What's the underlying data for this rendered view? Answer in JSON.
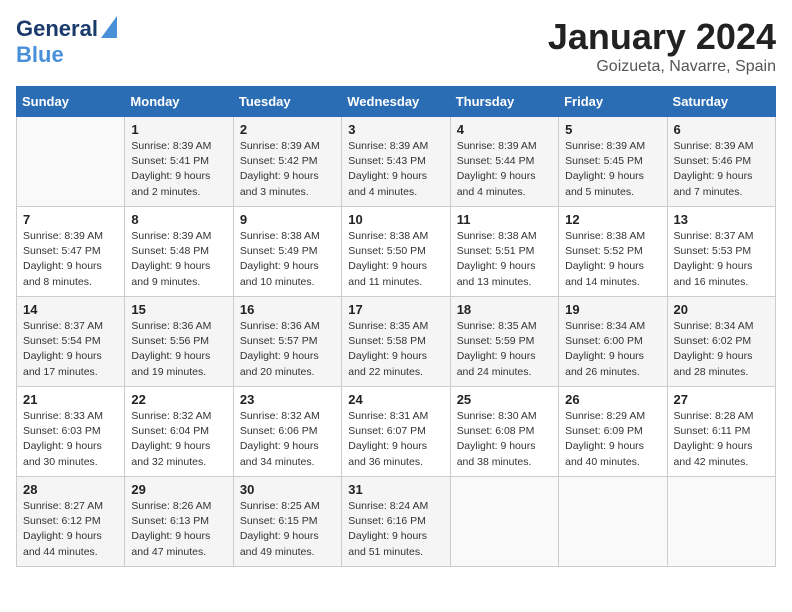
{
  "header": {
    "logo_line1": "General",
    "logo_line2": "Blue",
    "title": "January 2024",
    "subtitle": "Goizueta, Navarre, Spain"
  },
  "weekdays": [
    "Sunday",
    "Monday",
    "Tuesday",
    "Wednesday",
    "Thursday",
    "Friday",
    "Saturday"
  ],
  "weeks": [
    [
      {
        "day": "",
        "sunrise": "",
        "sunset": "",
        "daylight": ""
      },
      {
        "day": "1",
        "sunrise": "Sunrise: 8:39 AM",
        "sunset": "Sunset: 5:41 PM",
        "daylight": "Daylight: 9 hours and 2 minutes."
      },
      {
        "day": "2",
        "sunrise": "Sunrise: 8:39 AM",
        "sunset": "Sunset: 5:42 PM",
        "daylight": "Daylight: 9 hours and 3 minutes."
      },
      {
        "day": "3",
        "sunrise": "Sunrise: 8:39 AM",
        "sunset": "Sunset: 5:43 PM",
        "daylight": "Daylight: 9 hours and 4 minutes."
      },
      {
        "day": "4",
        "sunrise": "Sunrise: 8:39 AM",
        "sunset": "Sunset: 5:44 PM",
        "daylight": "Daylight: 9 hours and 4 minutes."
      },
      {
        "day": "5",
        "sunrise": "Sunrise: 8:39 AM",
        "sunset": "Sunset: 5:45 PM",
        "daylight": "Daylight: 9 hours and 5 minutes."
      },
      {
        "day": "6",
        "sunrise": "Sunrise: 8:39 AM",
        "sunset": "Sunset: 5:46 PM",
        "daylight": "Daylight: 9 hours and 7 minutes."
      }
    ],
    [
      {
        "day": "7",
        "sunrise": "Sunrise: 8:39 AM",
        "sunset": "Sunset: 5:47 PM",
        "daylight": "Daylight: 9 hours and 8 minutes."
      },
      {
        "day": "8",
        "sunrise": "Sunrise: 8:39 AM",
        "sunset": "Sunset: 5:48 PM",
        "daylight": "Daylight: 9 hours and 9 minutes."
      },
      {
        "day": "9",
        "sunrise": "Sunrise: 8:38 AM",
        "sunset": "Sunset: 5:49 PM",
        "daylight": "Daylight: 9 hours and 10 minutes."
      },
      {
        "day": "10",
        "sunrise": "Sunrise: 8:38 AM",
        "sunset": "Sunset: 5:50 PM",
        "daylight": "Daylight: 9 hours and 11 minutes."
      },
      {
        "day": "11",
        "sunrise": "Sunrise: 8:38 AM",
        "sunset": "Sunset: 5:51 PM",
        "daylight": "Daylight: 9 hours and 13 minutes."
      },
      {
        "day": "12",
        "sunrise": "Sunrise: 8:38 AM",
        "sunset": "Sunset: 5:52 PM",
        "daylight": "Daylight: 9 hours and 14 minutes."
      },
      {
        "day": "13",
        "sunrise": "Sunrise: 8:37 AM",
        "sunset": "Sunset: 5:53 PM",
        "daylight": "Daylight: 9 hours and 16 minutes."
      }
    ],
    [
      {
        "day": "14",
        "sunrise": "Sunrise: 8:37 AM",
        "sunset": "Sunset: 5:54 PM",
        "daylight": "Daylight: 9 hours and 17 minutes."
      },
      {
        "day": "15",
        "sunrise": "Sunrise: 8:36 AM",
        "sunset": "Sunset: 5:56 PM",
        "daylight": "Daylight: 9 hours and 19 minutes."
      },
      {
        "day": "16",
        "sunrise": "Sunrise: 8:36 AM",
        "sunset": "Sunset: 5:57 PM",
        "daylight": "Daylight: 9 hours and 20 minutes."
      },
      {
        "day": "17",
        "sunrise": "Sunrise: 8:35 AM",
        "sunset": "Sunset: 5:58 PM",
        "daylight": "Daylight: 9 hours and 22 minutes."
      },
      {
        "day": "18",
        "sunrise": "Sunrise: 8:35 AM",
        "sunset": "Sunset: 5:59 PM",
        "daylight": "Daylight: 9 hours and 24 minutes."
      },
      {
        "day": "19",
        "sunrise": "Sunrise: 8:34 AM",
        "sunset": "Sunset: 6:00 PM",
        "daylight": "Daylight: 9 hours and 26 minutes."
      },
      {
        "day": "20",
        "sunrise": "Sunrise: 8:34 AM",
        "sunset": "Sunset: 6:02 PM",
        "daylight": "Daylight: 9 hours and 28 minutes."
      }
    ],
    [
      {
        "day": "21",
        "sunrise": "Sunrise: 8:33 AM",
        "sunset": "Sunset: 6:03 PM",
        "daylight": "Daylight: 9 hours and 30 minutes."
      },
      {
        "day": "22",
        "sunrise": "Sunrise: 8:32 AM",
        "sunset": "Sunset: 6:04 PM",
        "daylight": "Daylight: 9 hours and 32 minutes."
      },
      {
        "day": "23",
        "sunrise": "Sunrise: 8:32 AM",
        "sunset": "Sunset: 6:06 PM",
        "daylight": "Daylight: 9 hours and 34 minutes."
      },
      {
        "day": "24",
        "sunrise": "Sunrise: 8:31 AM",
        "sunset": "Sunset: 6:07 PM",
        "daylight": "Daylight: 9 hours and 36 minutes."
      },
      {
        "day": "25",
        "sunrise": "Sunrise: 8:30 AM",
        "sunset": "Sunset: 6:08 PM",
        "daylight": "Daylight: 9 hours and 38 minutes."
      },
      {
        "day": "26",
        "sunrise": "Sunrise: 8:29 AM",
        "sunset": "Sunset: 6:09 PM",
        "daylight": "Daylight: 9 hours and 40 minutes."
      },
      {
        "day": "27",
        "sunrise": "Sunrise: 8:28 AM",
        "sunset": "Sunset: 6:11 PM",
        "daylight": "Daylight: 9 hours and 42 minutes."
      }
    ],
    [
      {
        "day": "28",
        "sunrise": "Sunrise: 8:27 AM",
        "sunset": "Sunset: 6:12 PM",
        "daylight": "Daylight: 9 hours and 44 minutes."
      },
      {
        "day": "29",
        "sunrise": "Sunrise: 8:26 AM",
        "sunset": "Sunset: 6:13 PM",
        "daylight": "Daylight: 9 hours and 47 minutes."
      },
      {
        "day": "30",
        "sunrise": "Sunrise: 8:25 AM",
        "sunset": "Sunset: 6:15 PM",
        "daylight": "Daylight: 9 hours and 49 minutes."
      },
      {
        "day": "31",
        "sunrise": "Sunrise: 8:24 AM",
        "sunset": "Sunset: 6:16 PM",
        "daylight": "Daylight: 9 hours and 51 minutes."
      },
      {
        "day": "",
        "sunrise": "",
        "sunset": "",
        "daylight": ""
      },
      {
        "day": "",
        "sunrise": "",
        "sunset": "",
        "daylight": ""
      },
      {
        "day": "",
        "sunrise": "",
        "sunset": "",
        "daylight": ""
      }
    ]
  ]
}
